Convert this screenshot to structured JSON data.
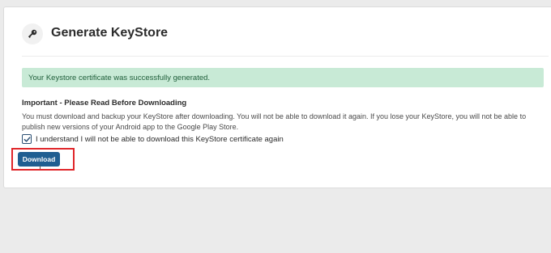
{
  "header": {
    "icon": "key-icon",
    "title": "Generate KeyStore"
  },
  "alert": {
    "message": "Your Keystore certificate was successfully generated."
  },
  "notice": {
    "heading": "Important - Please Read Before Downloading",
    "body": "You must download and backup your KeyStore after downloading. You will not be able to download it again. If you lose your KeyStore, you will not be able to publish new versions of your Android app to the Google Play Store."
  },
  "confirmation": {
    "checked": true,
    "label": "I understand I will not be able to download this KeyStore certificate again"
  },
  "actions": {
    "download_label": "Download"
  },
  "colors": {
    "success_bg": "#c8ead6",
    "button_bg": "#1f5e91",
    "highlight": "#e0262a"
  }
}
